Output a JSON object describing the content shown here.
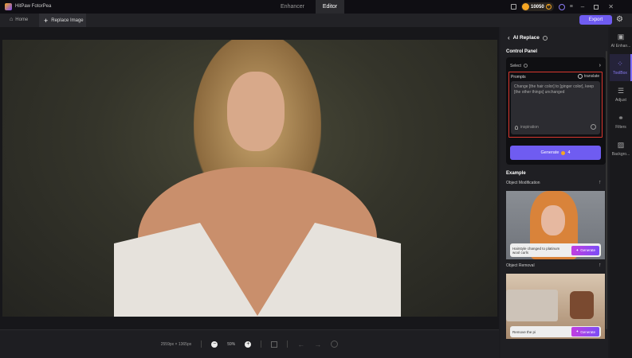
{
  "app": {
    "title": "HitPaw FotorPea",
    "top_tabs": [
      "Enhancer",
      "Editor"
    ],
    "active_tab": "Editor",
    "credits": "10050"
  },
  "tabs": {
    "home": "Home",
    "replace": "Replace Image",
    "export": "Export"
  },
  "panel": {
    "back_title": "AI Replace",
    "control_panel": "Control Panel",
    "select": "Select",
    "prompts": "Prompts",
    "translate": "translate",
    "prompt_text": "Change [the hair color] to [ginger color], keep [the other things] unchanged",
    "inspiration": "inspiration",
    "generate": "Generate",
    "generate_cost": "4",
    "example": "Example",
    "examples": [
      {
        "title": "Object Modification",
        "caption": "Hairstyle changed to platinum wool curls",
        "button": "Generate"
      },
      {
        "title": "Object Removal",
        "caption": "Remove the pi",
        "button": "Generate"
      }
    ]
  },
  "rail": [
    "AI Enhan...",
    "ToolBox",
    "Adjust",
    "Filters",
    "Backgro..."
  ],
  "bottom": {
    "dimensions": "2559px × 1365px",
    "zoom": "59%"
  },
  "colors": {
    "accent": "#6f5cf1",
    "prompt_border": "#d9372e"
  }
}
